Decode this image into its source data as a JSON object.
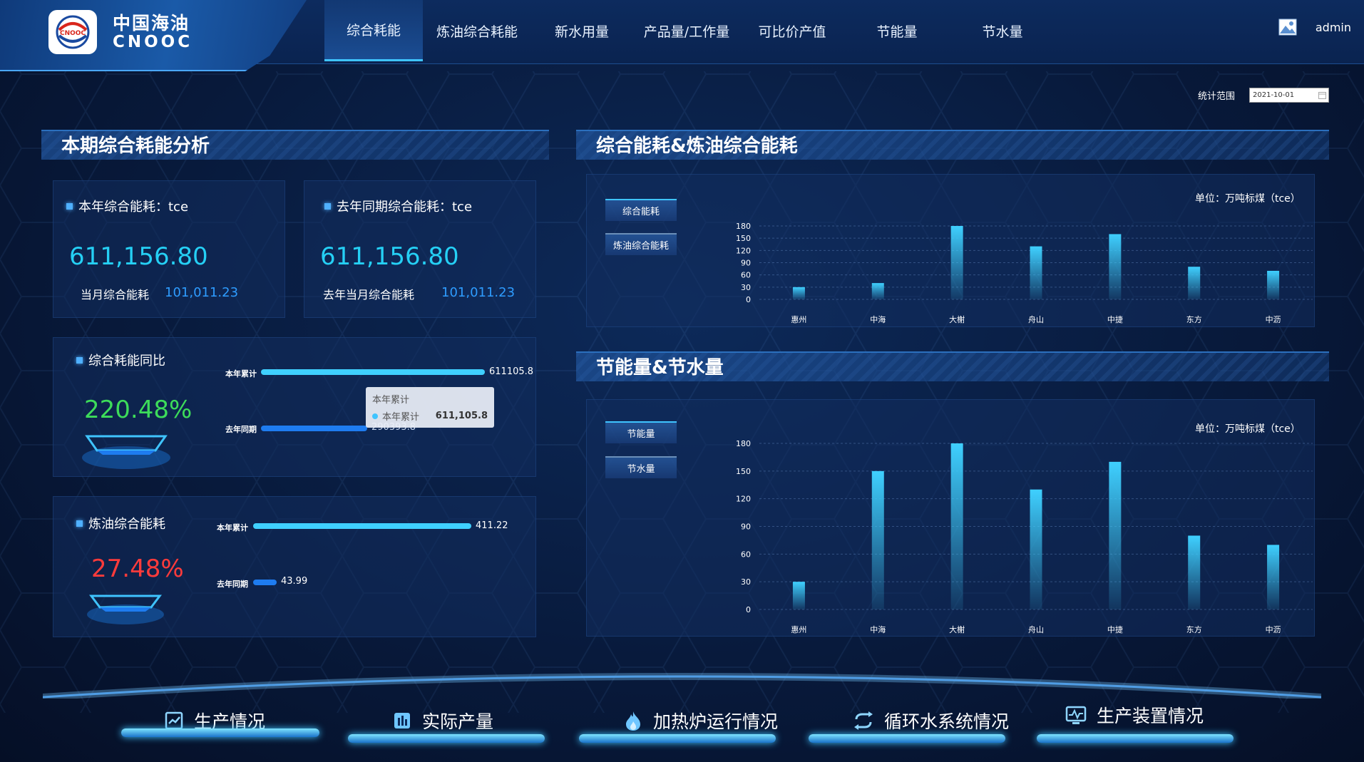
{
  "brand": {
    "name_cn": "中国海油",
    "name_en": "CNOOC",
    "logo_badge": "CNOOC"
  },
  "nav": {
    "items": [
      {
        "label": "综合耗能",
        "active": true
      },
      {
        "label": "炼油综合耗能",
        "active": false
      },
      {
        "label": "新水用量",
        "active": false
      },
      {
        "label": "产品量/工作量",
        "active": false
      },
      {
        "label": "可比价产值",
        "active": false
      },
      {
        "label": "节能量",
        "active": false
      },
      {
        "label": "节水量",
        "active": false
      }
    ],
    "user": "admin"
  },
  "filter": {
    "label": "统计范围",
    "date_value": "2021-10-01"
  },
  "left": {
    "title": "本期综合耗能分析",
    "this_year": {
      "label": "本年综合能耗：tce",
      "value": "611,156.80",
      "month_label": "当月综合能耗",
      "month_value": "101,011.23"
    },
    "last_year": {
      "label": "去年同期综合能耗：tce",
      "value": "611,156.80",
      "month_label": "去年当月综合能耗",
      "month_value": "101,011.23"
    },
    "yoy": {
      "label": "综合耗能同比",
      "pct": "220.48%",
      "bars": [
        {
          "label": "本年累计",
          "value": 611105.8,
          "value_text": "611105.8"
        },
        {
          "label": "去年同期",
          "value": 290000,
          "value_text": "290393.8"
        }
      ],
      "tooltip": {
        "title": "本年累计",
        "series": "本年累计",
        "value": "611,105.8"
      }
    },
    "refining": {
      "label": "炼油综合能耗",
      "pct": "27.48%",
      "bars": [
        {
          "label": "本年累计",
          "value": 411.22,
          "value_text": "411.22"
        },
        {
          "label": "去年同期",
          "value": 43.99,
          "value_text": "43.99"
        }
      ]
    }
  },
  "right_top": {
    "title": "综合能耗&炼油综合能耗",
    "legend": [
      "综合能耗",
      "炼油综合能耗"
    ],
    "unit": "单位：万吨标煤（tce）"
  },
  "right_bottom": {
    "title": "节能量&节水量",
    "legend": [
      "节能量",
      "节水量"
    ],
    "unit": "单位：万吨标煤（tce）"
  },
  "chart_data": [
    {
      "type": "bar",
      "categories": [
        "惠州",
        "中海",
        "大榭",
        "舟山",
        "中捷",
        "东方",
        "中沥"
      ],
      "series": [
        {
          "name": "综合能耗",
          "values": [
            30,
            40,
            180,
            130,
            160,
            80,
            70
          ]
        }
      ],
      "ylim": [
        0,
        180
      ],
      "yticks": [
        0,
        30,
        60,
        90,
        120,
        150,
        180
      ],
      "grid": true
    },
    {
      "type": "bar",
      "categories": [
        "惠州",
        "中海",
        "大榭",
        "舟山",
        "中捷",
        "东方",
        "中沥"
      ],
      "series": [
        {
          "name": "节能量",
          "values": [
            30,
            150,
            180,
            130,
            160,
            80,
            70
          ]
        }
      ],
      "ylim": [
        0,
        180
      ],
      "yticks": [
        0,
        30,
        60,
        90,
        120,
        150,
        180
      ],
      "grid": true
    }
  ],
  "bottom_nav": [
    {
      "label": "生产情况",
      "icon": "chart-board-icon"
    },
    {
      "label": "实际产量",
      "icon": "bar-chart-icon"
    },
    {
      "label": "加热炉运行情况",
      "icon": "flame-icon"
    },
    {
      "label": "循环水系统情况",
      "icon": "cycle-arrows-icon"
    },
    {
      "label": "生产装置情况",
      "icon": "monitor-wave-icon"
    }
  ],
  "colors": {
    "accent": "#25d0f5",
    "green": "#3ddc5a",
    "red": "#ff3b3b",
    "bar_top": "#3fd0ff",
    "bar_blue": "#1e7cf0"
  }
}
